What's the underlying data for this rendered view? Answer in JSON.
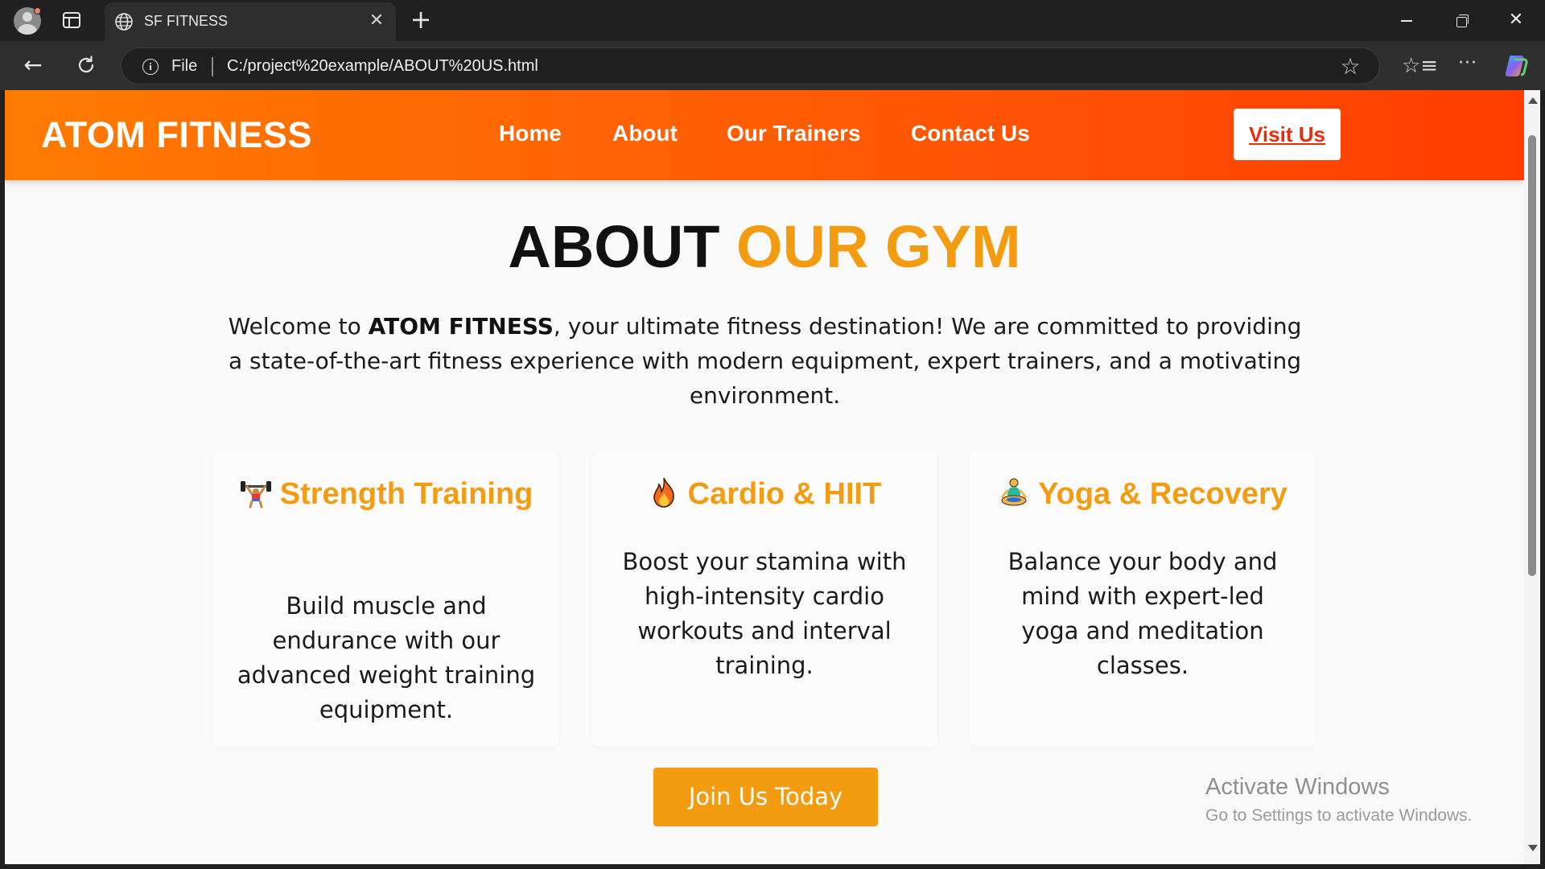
{
  "browser": {
    "tab_title": "SF FITNESS",
    "tab_close": "✕",
    "new_tab": "+",
    "address_scheme_label": "File",
    "url": "C:/project%20example/ABOUT%20US.html",
    "window_controls": {
      "close": "✕"
    },
    "icons": [
      "profile-icon",
      "tab-actions-icon",
      "globe-icon",
      "back-icon",
      "reload-icon",
      "info-icon",
      "star-icon",
      "favorites-icon",
      "more-icon",
      "copilot-icon"
    ]
  },
  "site": {
    "logo": "ATOM FITNESS",
    "nav": [
      "Home",
      "About",
      "Our Trainers",
      "Contact Us"
    ],
    "cta": "Visit Us",
    "colors": {
      "header_start": "#ff7b00",
      "header_end": "#ff3d00",
      "accent": "#f39c12",
      "cta_text": "#e62e0c"
    }
  },
  "about": {
    "heading_main": "ABOUT",
    "heading_accent": "OUR GYM",
    "intro_before": "Welcome to ",
    "intro_brand": "ATOM FITNESS",
    "intro_after": ", your ultimate fitness destination! We are committed to providing a state-of-the-art fitness experience with modern equipment, expert trainers, and a motivating environment."
  },
  "features": [
    {
      "icon": "weightlifter-icon",
      "title": "Strength Training",
      "text": "Build muscle and endurance with our advanced weight training equipment."
    },
    {
      "icon": "fire-icon",
      "title": "Cardio & HIIT",
      "text": "Boost your stamina with high-intensity cardio workouts and interval training."
    },
    {
      "icon": "yoga-icon",
      "title": "Yoga & Recovery",
      "text": "Balance your body and mind with expert-led yoga and meditation classes."
    }
  ],
  "join_button": "Join Us Today",
  "watermark": {
    "title": "Activate Windows",
    "subtitle": "Go to Settings to activate Windows."
  }
}
